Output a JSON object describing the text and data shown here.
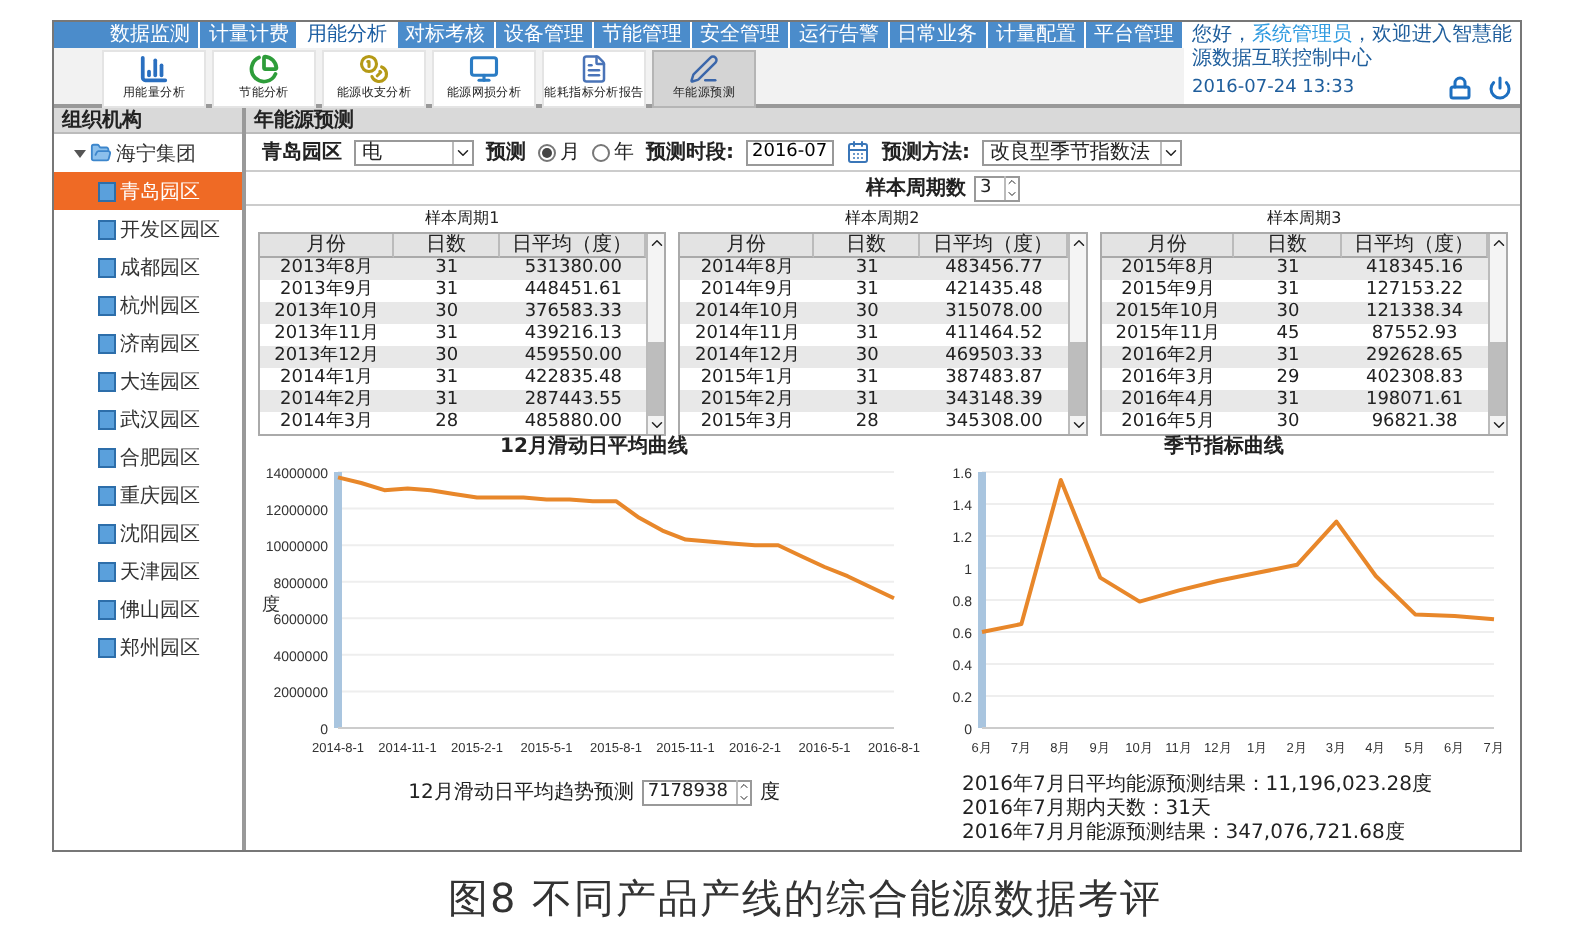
{
  "nav_tabs": [
    {
      "label": "数据监测",
      "selected": false
    },
    {
      "label": "计量计费",
      "selected": false
    },
    {
      "label": "用能分析",
      "selected": true
    },
    {
      "label": "对标考核",
      "selected": false
    },
    {
      "label": "设备管理",
      "selected": false
    },
    {
      "label": "节能管理",
      "selected": false
    },
    {
      "label": "安全管理",
      "selected": false
    },
    {
      "label": "运行告警",
      "selected": false
    },
    {
      "label": "日常业务",
      "selected": false
    },
    {
      "label": "计量配置",
      "selected": false
    },
    {
      "label": "平台管理",
      "selected": false
    }
  ],
  "greeting": {
    "prefix": "您好，",
    "user": "系统管理员",
    "suffix": "，欢迎进入智慧能源数据互联控制中心"
  },
  "datetime": "2016-07-24 13:33",
  "toolbar": [
    {
      "label": "用能量分析",
      "kind": "bars",
      "selected": false
    },
    {
      "label": "节能分析",
      "kind": "pie",
      "selected": false
    },
    {
      "label": "能源收支分析",
      "kind": "coins",
      "selected": false
    },
    {
      "label": "能源网损分析",
      "kind": "monitor",
      "selected": false
    },
    {
      "label": "能耗指标分析报告",
      "kind": "report",
      "selected": false
    },
    {
      "label": "年能源预测",
      "kind": "pen",
      "selected": true
    }
  ],
  "sidebar": {
    "title": "组织机构",
    "tree": [
      {
        "label": "海宁集团",
        "expanded": true,
        "selected": false,
        "children": [
          {
            "label": "青岛园区",
            "selected": true
          },
          {
            "label": "开发区园区",
            "selected": false
          },
          {
            "label": "成都园区",
            "selected": false
          },
          {
            "label": "杭州园区",
            "selected": false
          },
          {
            "label": "济南园区",
            "selected": false
          },
          {
            "label": "大连园区",
            "selected": false
          },
          {
            "label": "武汉园区",
            "selected": false
          },
          {
            "label": "合肥园区",
            "selected": false
          },
          {
            "label": "重庆园区",
            "selected": false
          },
          {
            "label": "沈阳园区",
            "selected": false
          },
          {
            "label": "天津园区",
            "selected": false
          },
          {
            "label": "佛山园区",
            "selected": false
          },
          {
            "label": "郑州园区",
            "selected": false
          }
        ]
      }
    ]
  },
  "panel": {
    "title": "年能源预测"
  },
  "form": {
    "park": "青岛园区",
    "energy_select": "电",
    "predict_label": "预测",
    "period_options": [
      {
        "label": "月",
        "selected": true
      },
      {
        "label": "年",
        "selected": false
      }
    ],
    "period_label": "预测时段:",
    "period_value": "2016-07",
    "method_label": "预测方法:",
    "method_select": "改良型季节指数法",
    "sample_label": "样本周期数",
    "sample_value": "3"
  },
  "tables": [
    {
      "title": "样本周期1",
      "columns": [
        "月份",
        "日数",
        "日平均（度）"
      ],
      "rows": [
        [
          "2013年8月",
          "31",
          "531380.00"
        ],
        [
          "2013年9月",
          "31",
          "448451.61"
        ],
        [
          "2013年10月",
          "30",
          "376583.33"
        ],
        [
          "2013年11月",
          "31",
          "439216.13"
        ],
        [
          "2013年12月",
          "30",
          "459550.00"
        ],
        [
          "2014年1月",
          "31",
          "422835.48"
        ],
        [
          "2014年2月",
          "31",
          "287443.55"
        ],
        [
          "2014年3月",
          "28",
          "485880.00"
        ]
      ]
    },
    {
      "title": "样本周期2",
      "columns": [
        "月份",
        "日数",
        "日平均（度）"
      ],
      "rows": [
        [
          "2014年8月",
          "31",
          "483456.77"
        ],
        [
          "2014年9月",
          "31",
          "421435.48"
        ],
        [
          "2014年10月",
          "30",
          "315078.00"
        ],
        [
          "2014年11月",
          "31",
          "411464.52"
        ],
        [
          "2014年12月",
          "30",
          "469503.33"
        ],
        [
          "2015年1月",
          "31",
          "387483.87"
        ],
        [
          "2015年2月",
          "31",
          "343148.39"
        ],
        [
          "2015年3月",
          "28",
          "345308.00"
        ]
      ]
    },
    {
      "title": "样本周期3",
      "columns": [
        "月份",
        "日数",
        "日平均（度）"
      ],
      "rows": [
        [
          "2015年8月",
          "31",
          "418345.16"
        ],
        [
          "2015年9月",
          "31",
          "127153.22"
        ],
        [
          "2015年10月",
          "30",
          "121338.34"
        ],
        [
          "2015年11月",
          "45",
          "87552.93"
        ],
        [
          "2016年2月",
          "31",
          "292628.65"
        ],
        [
          "2016年3月",
          "29",
          "402308.83"
        ],
        [
          "2016年4月",
          "31",
          "198071.61"
        ],
        [
          "2016年5月",
          "30",
          "96821.38"
        ]
      ]
    }
  ],
  "charts": [
    {
      "chart_data": {
        "type": "line",
        "title": "12月滑动日平均曲线",
        "ylabel": "度",
        "grid": true,
        "categories": [
          "2014-8-1",
          null,
          null,
          "2014-11-1",
          null,
          null,
          "2015-2-1",
          null,
          null,
          "2015-5-1",
          null,
          null,
          "2015-8-1",
          null,
          null,
          "2015-11-1",
          null,
          null,
          "2016-2-1",
          null,
          null,
          "2016-5-1",
          null,
          null,
          "2016-8-1"
        ],
        "series": [
          {
            "color": "#e8872a",
            "values": [
              13700000,
              13400000,
              13000000,
              13100000,
              13000000,
              12800000,
              12600000,
              12600000,
              12600000,
              12500000,
              12500000,
              12400000,
              12400000,
              11500000,
              10800000,
              10300000,
              10200000,
              10100000,
              10000000,
              10000000,
              9400000,
              8800000,
              8300000,
              7700000,
              7100000
            ]
          }
        ],
        "ylim": [
          0,
          14000000
        ],
        "yticks": [
          0,
          2000000,
          4000000,
          6000000,
          8000000,
          10000000,
          12000000,
          14000000
        ]
      }
    },
    {
      "chart_data": {
        "type": "line",
        "title": "季节指标曲线",
        "grid": true,
        "categories": [
          "6月",
          "7月",
          "8月",
          "9月",
          "10月",
          "11月",
          "12月",
          "1月",
          "2月",
          "3月",
          "4月",
          "5月",
          "6月",
          "7月"
        ],
        "series": [
          {
            "color": "#e8872a",
            "values": [
              0.6,
              0.65,
              1.55,
              0.94,
              0.79,
              0.86,
              0.92,
              0.97,
              1.02,
              1.29,
              0.95,
              0.71,
              0.7,
              0.68
            ]
          }
        ],
        "ylim": [
          0,
          1.6
        ],
        "yticks": [
          0,
          0.2,
          0.4,
          0.6,
          0.8,
          1,
          1.2,
          1.4,
          1.6
        ]
      }
    }
  ],
  "trend": {
    "label": "12月滑动日平均趋势预测",
    "value": "7178938",
    "unit": "度"
  },
  "results": [
    "2016年7月日平均能源预测结果：11,196,023.28度",
    "2016年7月期内天数：31天",
    "2016年7月月能源预测结果：347,076,721.68度"
  ],
  "caption": "图8 不同产品产线的综合能源数据考评"
}
